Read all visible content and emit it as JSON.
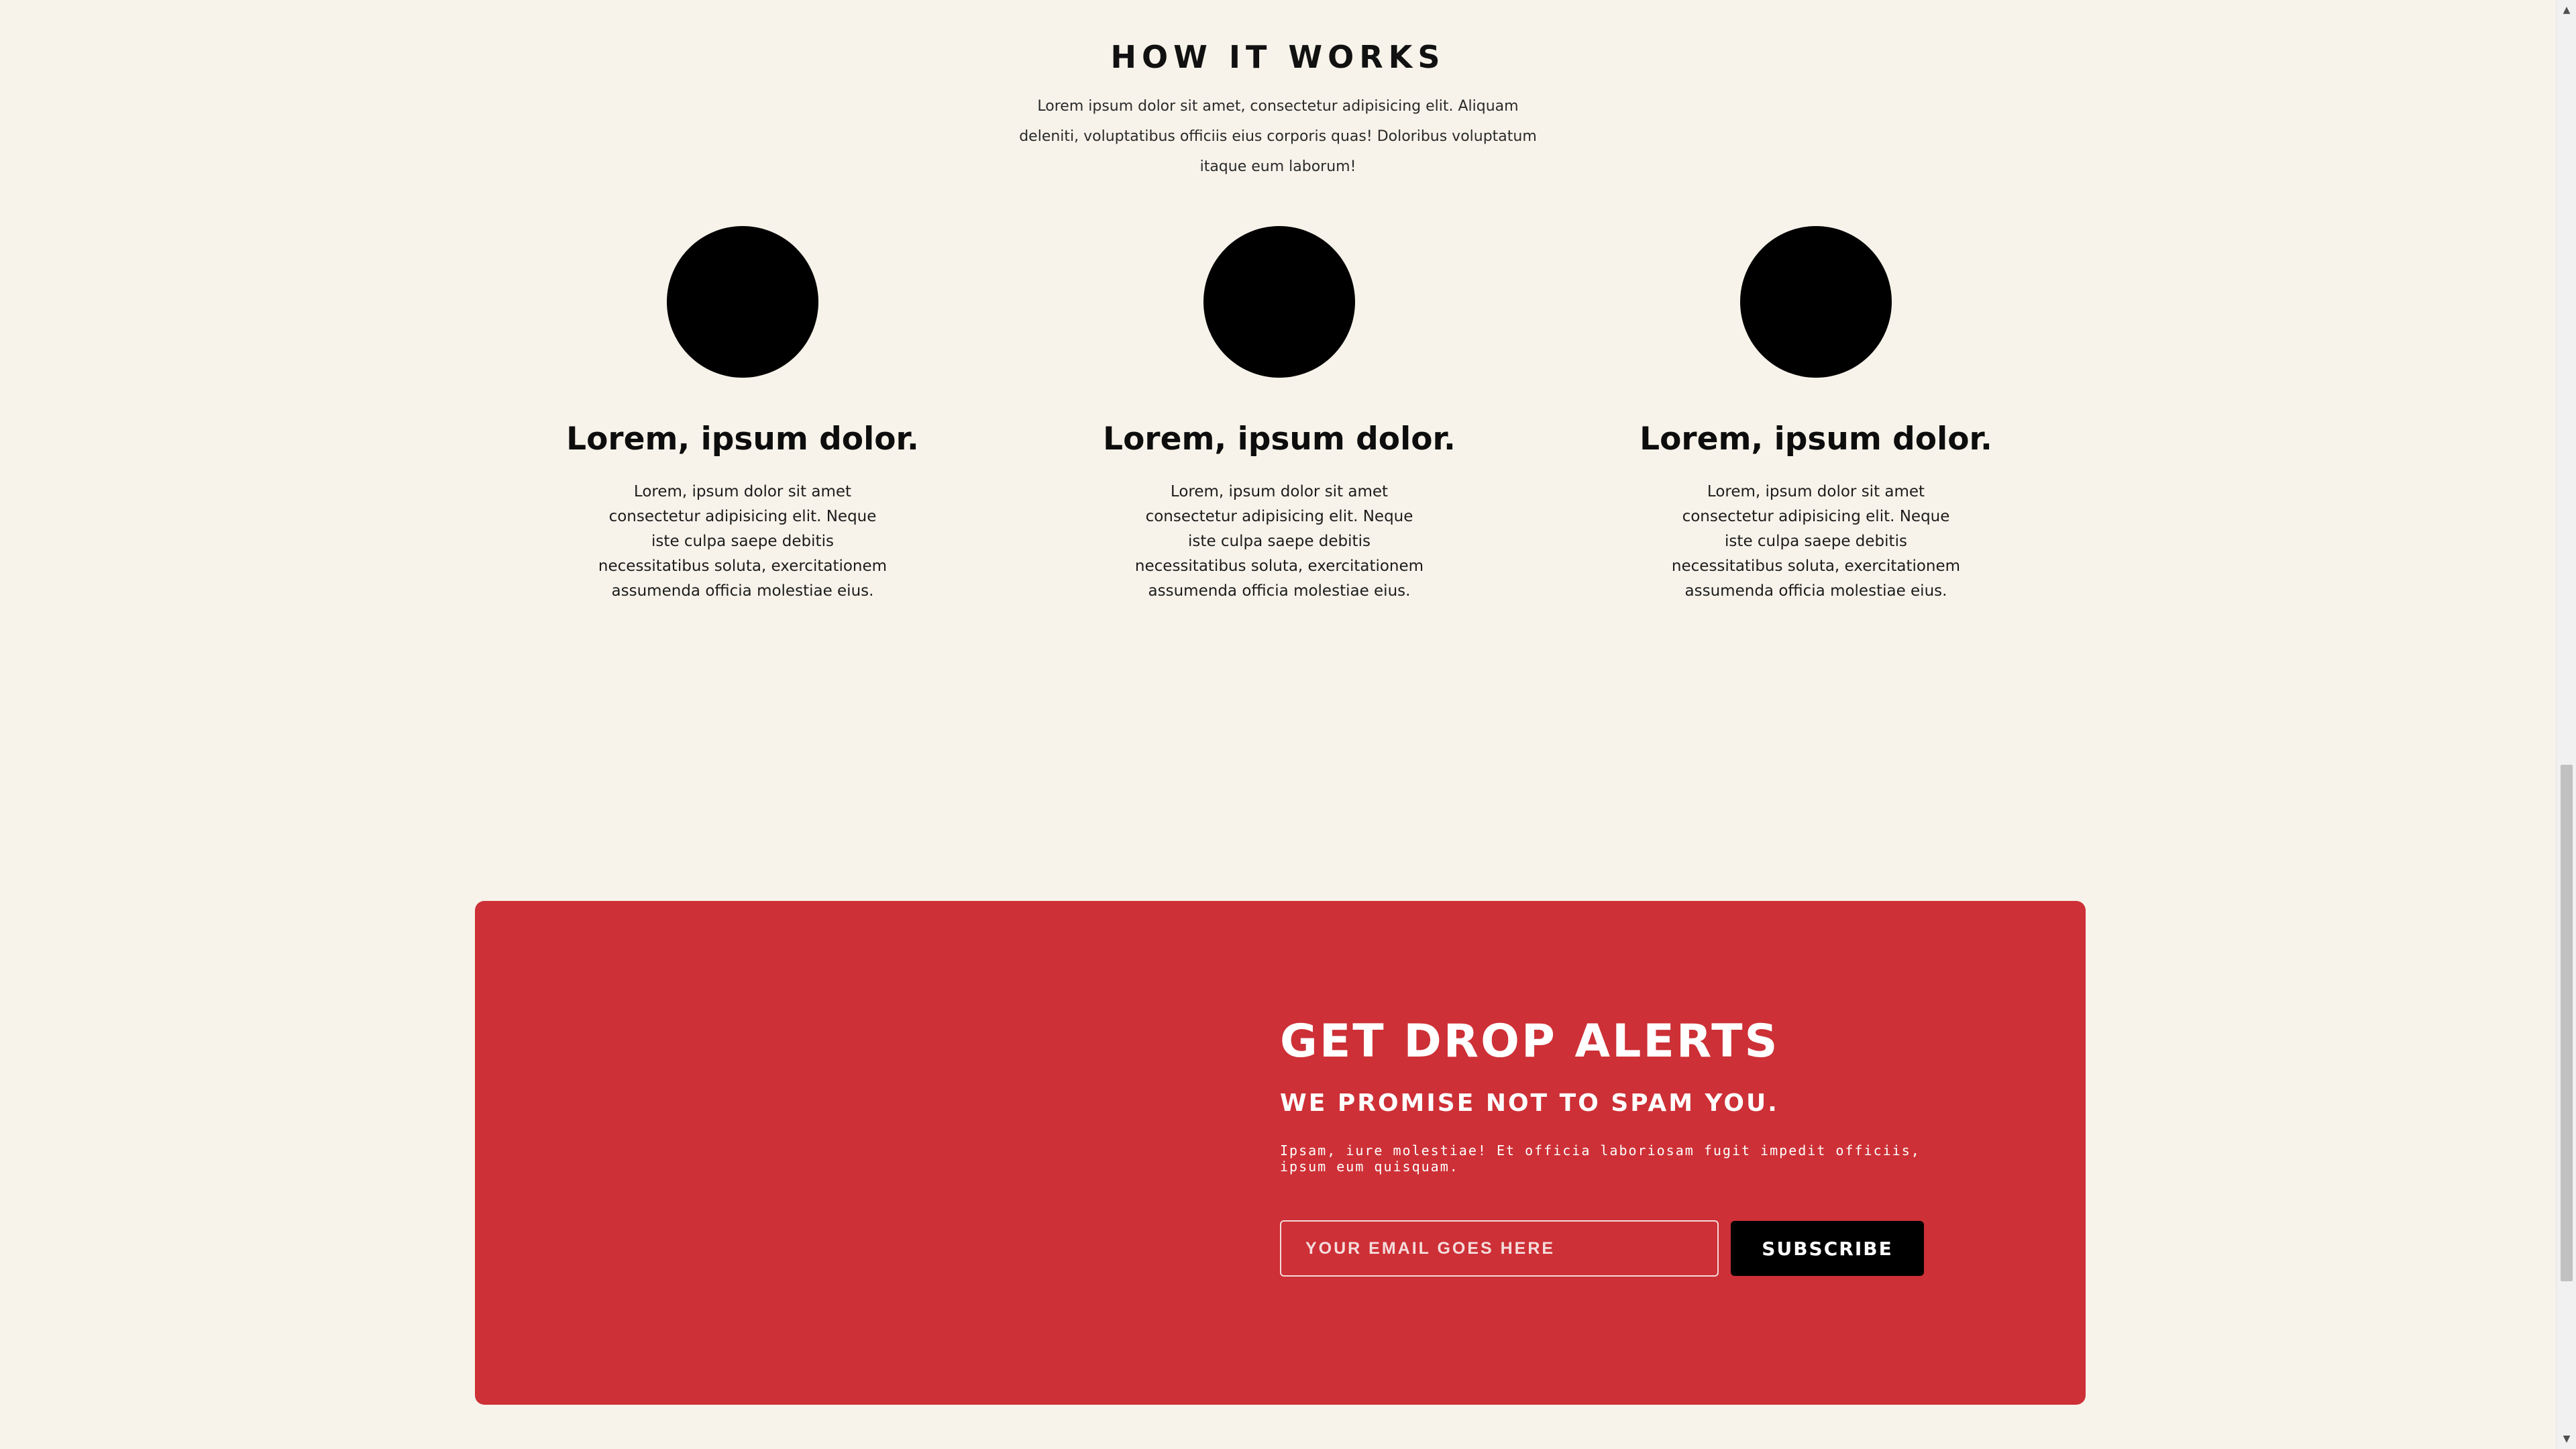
{
  "how_it_works": {
    "title": "HOW IT WORKS",
    "intro": "Lorem ipsum dolor sit amet, consectetur adipisicing elit. Aliquam deleniti, voluptatibus officiis eius corporis quas! Doloribus voluptatum itaque eum laborum!",
    "steps": [
      {
        "icon": "black-circle",
        "heading": "Lorem, ipsum dolor.",
        "text": "Lorem, ipsum dolor sit amet consectetur adipisicing elit. Neque iste culpa saepe debitis necessitatibus soluta, exercitationem assumenda officia molestiae eius."
      },
      {
        "icon": "black-circle",
        "heading": "Lorem, ipsum dolor.",
        "text": "Lorem, ipsum dolor sit amet consectetur adipisicing elit. Neque iste culpa saepe debitis necessitatibus soluta, exercitationem assumenda officia molestiae eius."
      },
      {
        "icon": "black-circle",
        "heading": "Lorem, ipsum dolor.",
        "text": "Lorem, ipsum dolor sit amet consectetur adipisicing elit. Neque iste culpa saepe debitis necessitatibus soluta, exercitationem assumenda officia molestiae eius."
      }
    ]
  },
  "drop_alerts": {
    "title": "GET DROP ALERTS",
    "subtitle": "WE PROMISE NOT TO SPAM YOU.",
    "text": "Ipsam, iure molestiae! Et officia laboriosam fugit impedit officiis, ipsum eum quisquam.",
    "email_placeholder": "YOUR EMAIL GOES HERE",
    "subscribe_label": "SUBSCRIBE"
  },
  "colors": {
    "page_background": "#f7f3ea",
    "banner_background": "#cd3036",
    "circle": "#000000",
    "button_background": "#000000",
    "banner_text": "#ffffff"
  },
  "scrollbar": {
    "up_icon": "triangle-up-icon",
    "down_icon": "triangle-down-icon"
  }
}
